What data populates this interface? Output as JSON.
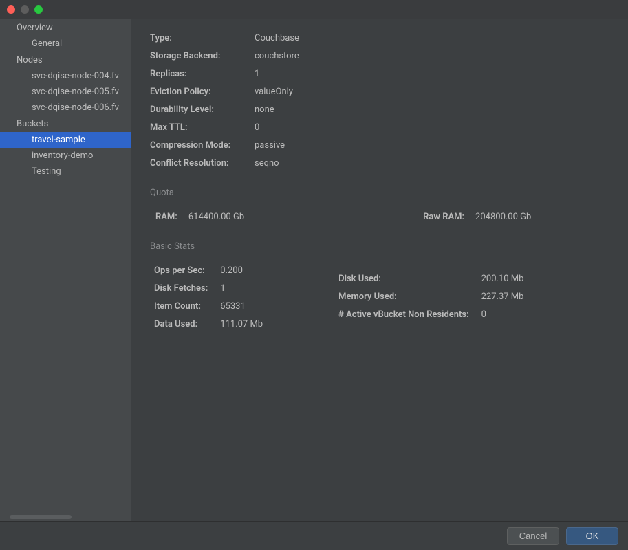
{
  "sidebar": {
    "items": [
      {
        "label": "Overview",
        "type": "header"
      },
      {
        "label": "General",
        "type": "child"
      },
      {
        "label": "Nodes",
        "type": "header"
      },
      {
        "label": "svc-dqise-node-004.fv",
        "type": "child"
      },
      {
        "label": "svc-dqise-node-005.fv",
        "type": "child"
      },
      {
        "label": "svc-dqise-node-006.fv",
        "type": "child"
      },
      {
        "label": "Buckets",
        "type": "header"
      },
      {
        "label": "travel-sample",
        "type": "child",
        "selected": true
      },
      {
        "label": "inventory-demo",
        "type": "child"
      },
      {
        "label": "Testing",
        "type": "child"
      }
    ]
  },
  "properties": {
    "type_label": "Type:",
    "type_value": "Couchbase",
    "storage_backend_label": "Storage Backend:",
    "storage_backend_value": "couchstore",
    "replicas_label": "Replicas:",
    "replicas_value": "1",
    "eviction_policy_label": "Eviction Policy:",
    "eviction_policy_value": "valueOnly",
    "durability_level_label": "Durability Level:",
    "durability_level_value": "none",
    "max_ttl_label": "Max TTL:",
    "max_ttl_value": "0",
    "compression_mode_label": "Compression Mode:",
    "compression_mode_value": "passive",
    "conflict_resolution_label": "Conflict Resolution:",
    "conflict_resolution_value": "seqno"
  },
  "quota": {
    "title": "Quota",
    "ram_label": "RAM:",
    "ram_value": "614400.00 Gb",
    "raw_ram_label": "Raw RAM:",
    "raw_ram_value": "204800.00 Gb"
  },
  "stats": {
    "title": "Basic Stats",
    "ops_per_sec_label": "Ops per Sec:",
    "ops_per_sec_value": "0.200",
    "disk_fetches_label": "Disk Fetches:",
    "disk_fetches_value": "1",
    "item_count_label": "Item Count:",
    "item_count_value": "65331",
    "data_used_label": "Data Used:",
    "data_used_value": "111.07 Mb",
    "disk_used_label": "Disk Used:",
    "disk_used_value": "200.10 Mb",
    "memory_used_label": "Memory Used:",
    "memory_used_value": "227.37 Mb",
    "active_vbucket_label": "# Active vBucket Non Residents:",
    "active_vbucket_value": "0"
  },
  "footer": {
    "cancel_label": "Cancel",
    "ok_label": "OK"
  }
}
